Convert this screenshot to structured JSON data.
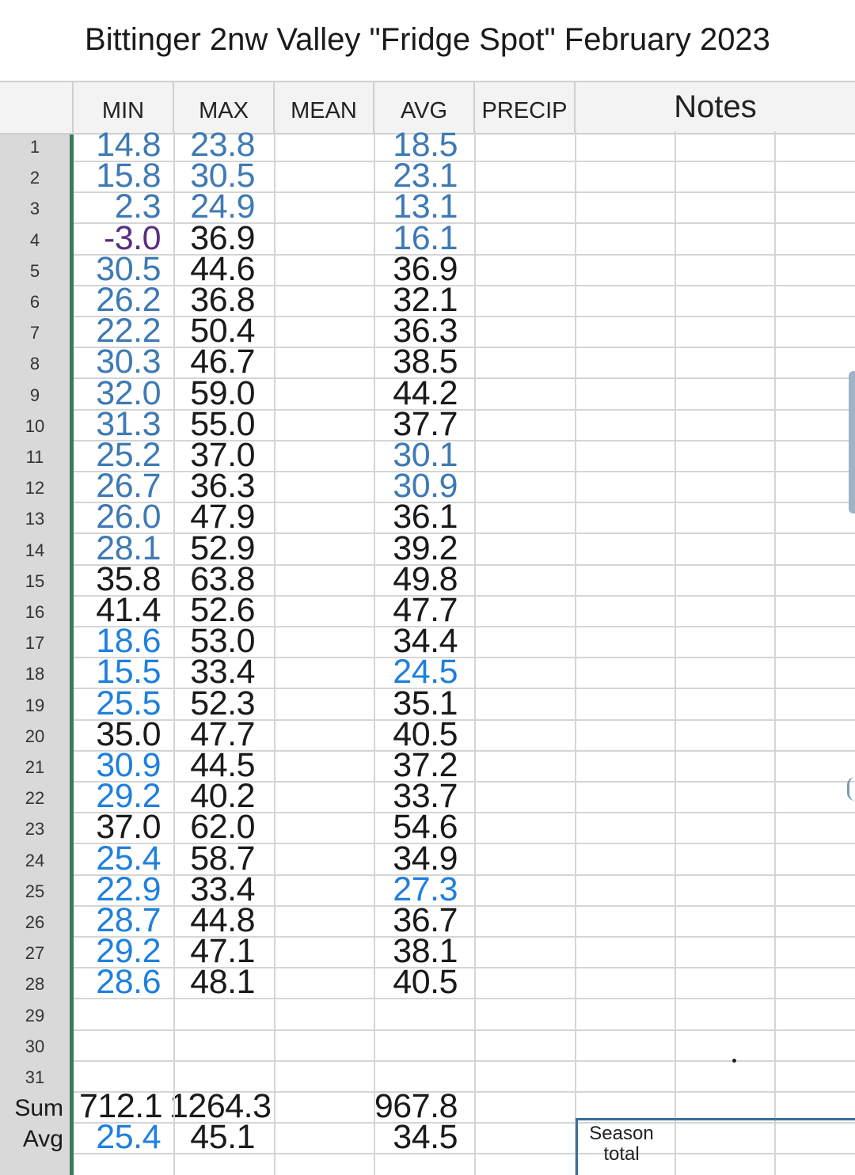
{
  "title": "Bittinger 2nw Valley \"Fridge Spot\" February 2023",
  "headers": {
    "min": "MIN",
    "max": "MAX",
    "mean": "MEAN",
    "avg": "AVG",
    "precip": "PRECIP",
    "notes": "Notes"
  },
  "rows": [
    {
      "n": "1",
      "min": "14.8",
      "max": "23.8",
      "avg": "18.5",
      "minColor": "blue",
      "maxColor": "blue",
      "avgColor": "blue"
    },
    {
      "n": "2",
      "min": "15.8",
      "max": "30.5",
      "avg": "23.1",
      "minColor": "blue",
      "maxColor": "blue",
      "avgColor": "blue"
    },
    {
      "n": "3",
      "min": "2.3",
      "max": "24.9",
      "avg": "13.1",
      "minColor": "blue",
      "maxColor": "blue",
      "avgColor": "blue"
    },
    {
      "n": "4",
      "min": "-3.0",
      "max": "36.9",
      "avg": "16.1",
      "minColor": "purple",
      "maxColor": "black",
      "avgColor": "blue"
    },
    {
      "n": "5",
      "min": "30.5",
      "max": "44.6",
      "avg": "36.9",
      "minColor": "blue",
      "maxColor": "black",
      "avgColor": "black"
    },
    {
      "n": "6",
      "min": "26.2",
      "max": "36.8",
      "avg": "32.1",
      "minColor": "blue",
      "maxColor": "black",
      "avgColor": "black"
    },
    {
      "n": "7",
      "min": "22.2",
      "max": "50.4",
      "avg": "36.3",
      "minColor": "blue",
      "maxColor": "black",
      "avgColor": "black"
    },
    {
      "n": "8",
      "min": "30.3",
      "max": "46.7",
      "avg": "38.5",
      "minColor": "blue",
      "maxColor": "black",
      "avgColor": "black"
    },
    {
      "n": "9",
      "min": "32.0",
      "max": "59.0",
      "avg": "44.2",
      "minColor": "blue",
      "maxColor": "black",
      "avgColor": "black"
    },
    {
      "n": "10",
      "min": "31.3",
      "max": "55.0",
      "avg": "37.7",
      "minColor": "blue",
      "maxColor": "black",
      "avgColor": "black"
    },
    {
      "n": "11",
      "min": "25.2",
      "max": "37.0",
      "avg": "30.1",
      "minColor": "blue",
      "maxColor": "black",
      "avgColor": "blue"
    },
    {
      "n": "12",
      "min": "26.7",
      "max": "36.3",
      "avg": "30.9",
      "minColor": "blue",
      "maxColor": "black",
      "avgColor": "blue"
    },
    {
      "n": "13",
      "min": "26.0",
      "max": "47.9",
      "avg": "36.1",
      "minColor": "blue",
      "maxColor": "black",
      "avgColor": "black"
    },
    {
      "n": "14",
      "min": "28.1",
      "max": "52.9",
      "avg": "39.2",
      "minColor": "blue",
      "maxColor": "black",
      "avgColor": "black"
    },
    {
      "n": "15",
      "min": "35.8",
      "max": "63.8",
      "avg": "49.8",
      "minColor": "black",
      "maxColor": "black",
      "avgColor": "black"
    },
    {
      "n": "16",
      "min": "41.4",
      "max": "52.6",
      "avg": "47.7",
      "minColor": "black",
      "maxColor": "black",
      "avgColor": "black"
    },
    {
      "n": "17",
      "min": "18.6",
      "max": "53.0",
      "avg": "34.4",
      "minColor": "bright",
      "maxColor": "black",
      "avgColor": "black"
    },
    {
      "n": "18",
      "min": "15.5",
      "max": "33.4",
      "avg": "24.5",
      "minColor": "bright",
      "maxColor": "black",
      "avgColor": "bright"
    },
    {
      "n": "19",
      "min": "25.5",
      "max": "52.3",
      "avg": "35.1",
      "minColor": "bright",
      "maxColor": "black",
      "avgColor": "black"
    },
    {
      "n": "20",
      "min": "35.0",
      "max": "47.7",
      "avg": "40.5",
      "minColor": "black",
      "maxColor": "black",
      "avgColor": "black"
    },
    {
      "n": "21",
      "min": "30.9",
      "max": "44.5",
      "avg": "37.2",
      "minColor": "bright",
      "maxColor": "black",
      "avgColor": "black"
    },
    {
      "n": "22",
      "min": "29.2",
      "max": "40.2",
      "avg": "33.7",
      "minColor": "bright",
      "maxColor": "black",
      "avgColor": "black"
    },
    {
      "n": "23",
      "min": "37.0",
      "max": "62.0",
      "avg": "54.6",
      "minColor": "black",
      "maxColor": "black",
      "avgColor": "black"
    },
    {
      "n": "24",
      "min": "25.4",
      "max": "58.7",
      "avg": "34.9",
      "minColor": "bright",
      "maxColor": "black",
      "avgColor": "black"
    },
    {
      "n": "25",
      "min": "22.9",
      "max": "33.4",
      "avg": "27.3",
      "minColor": "bright",
      "maxColor": "black",
      "avgColor": "bright"
    },
    {
      "n": "26",
      "min": "28.7",
      "max": "44.8",
      "avg": "36.7",
      "minColor": "bright",
      "maxColor": "black",
      "avgColor": "black"
    },
    {
      "n": "27",
      "min": "29.2",
      "max": "47.1",
      "avg": "38.1",
      "minColor": "bright",
      "maxColor": "black",
      "avgColor": "black"
    },
    {
      "n": "28",
      "min": "28.6",
      "max": "48.1",
      "avg": "40.5",
      "minColor": "bright",
      "maxColor": "black",
      "avgColor": "black"
    },
    {
      "n": "29",
      "min": "",
      "max": "",
      "avg": "",
      "minColor": "black",
      "maxColor": "black",
      "avgColor": "black"
    },
    {
      "n": "30",
      "min": "",
      "max": "",
      "avg": "",
      "minColor": "black",
      "maxColor": "black",
      "avgColor": "black"
    },
    {
      "n": "31",
      "min": "",
      "max": "",
      "avg": "",
      "minColor": "black",
      "maxColor": "black",
      "avgColor": "black"
    }
  ],
  "sum": {
    "label": "Sum",
    "min": "712.1",
    "max": "1264.3",
    "avg": "967.8"
  },
  "average": {
    "label": "Avg",
    "min": "25.4",
    "max": "45.1",
    "avg": "34.5",
    "minColor": "bright"
  },
  "season": {
    "line1": "Season",
    "line2": "total"
  }
}
